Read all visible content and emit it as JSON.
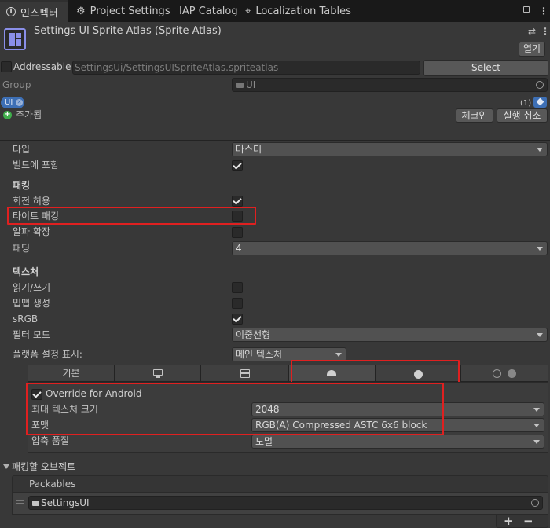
{
  "tabs": [
    {
      "label": "인스펙터",
      "icon": "info-icon"
    },
    {
      "label": "Project Settings",
      "icon": "gear-icon"
    },
    {
      "label": "IAP Catalog",
      "icon": ""
    },
    {
      "label": "Localization Tables",
      "icon": "globe-icon"
    }
  ],
  "header": {
    "title": "Settings UI Sprite Atlas (Sprite Atlas)",
    "open_button": "열기"
  },
  "addressable": {
    "label": "Addressable",
    "checked": false,
    "path": "SettingsUi/SettingsUISpriteAtlas.spriteatlas",
    "select_button": "Select",
    "group_label": "Group",
    "group_value": "UI",
    "tag": "UI",
    "tag_count": "(1)"
  },
  "added_label": "추가됨",
  "checkin_button": "체크인",
  "undo_button": "실행 취소",
  "type": {
    "label": "타입",
    "value": "마스터"
  },
  "include_in_build": {
    "label": "빌드에 포함",
    "checked": true
  },
  "packing": {
    "header": "패킹",
    "allow_rotation": {
      "label": "회전 허용",
      "checked": true
    },
    "tight_packing": {
      "label": "타이트 패킹",
      "checked": false
    },
    "alpha_dilation": {
      "label": "알파 확장",
      "checked": false
    },
    "padding": {
      "label": "패딩",
      "value": "4"
    }
  },
  "texture": {
    "header": "텍스처",
    "read_write": {
      "label": "읽기/쓰기",
      "checked": false
    },
    "mipmaps": {
      "label": "밉맵 생성",
      "checked": false
    },
    "srgb": {
      "label": "sRGB",
      "checked": true
    },
    "filter_mode": {
      "label": "필터 모드",
      "value": "이중선형"
    }
  },
  "platform": {
    "label": "플랫폼 설정 표시:",
    "value": "메인 텍스처",
    "tabs": [
      "기본",
      "standalone-icon",
      "grid-icon",
      "android-icon",
      "apple-icon",
      "web-icon"
    ],
    "override_label": "Override for Android",
    "override_checked": true,
    "max_size": {
      "label": "최대 텍스처 크기",
      "value": "2048"
    },
    "format": {
      "label": "포맷",
      "value": "RGB(A) Compressed ASTC 6x6 block"
    },
    "compression": {
      "label": "압축 품질",
      "value": "노멀"
    }
  },
  "objects": {
    "header": "패킹할 오브젝트",
    "list_header": "Packables",
    "items": [
      "SettingsUI"
    ]
  },
  "colors": {
    "highlight": "#e02020",
    "tag_blue": "#3d6fb5",
    "accent_green": "#3fae4b"
  }
}
